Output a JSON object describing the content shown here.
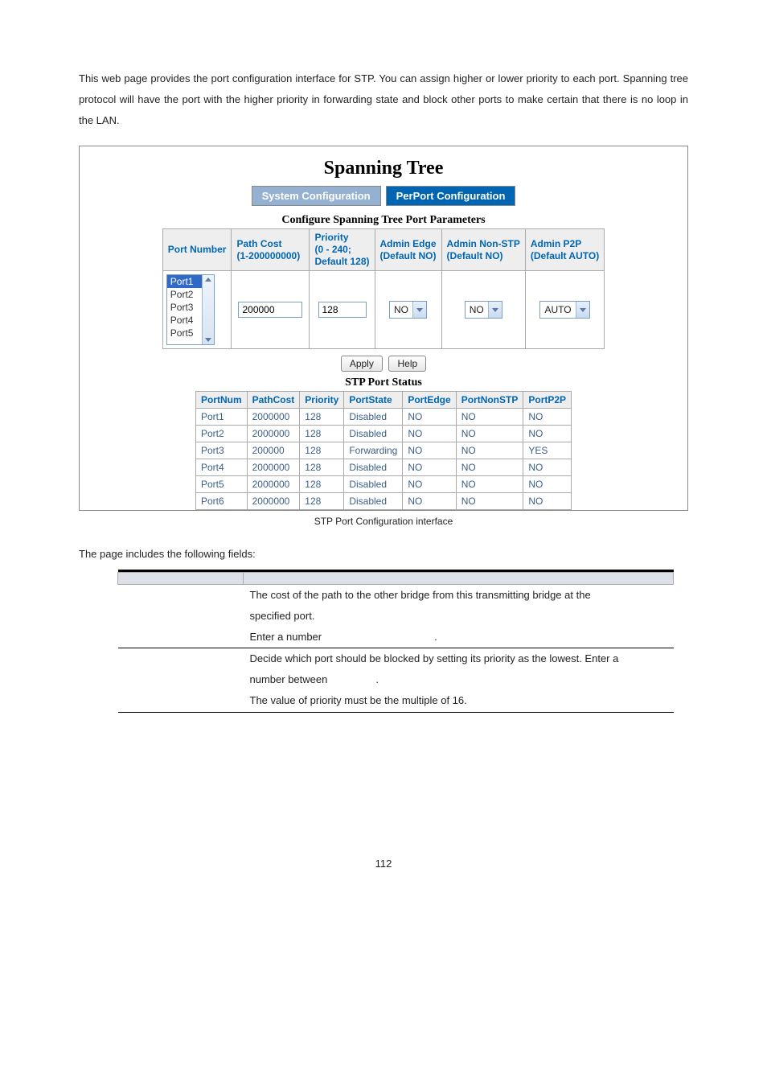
{
  "intro": "This web page provides the port configuration interface for STP. You can assign higher or lower priority to each port. Spanning tree protocol will have the port with the higher priority in forwarding state and block other ports to make certain that there is no loop in the LAN.",
  "screenshot": {
    "title": "Spanning Tree",
    "tabs": {
      "system": "System Configuration",
      "perport": "PerPort Configuration"
    },
    "configure_title": "Configure Spanning Tree Port Parameters",
    "config_headers": {
      "port_number": "Port Number",
      "path_cost": "Path Cost\n(1-200000000)",
      "priority": "Priority\n(0 - 240;\nDefault 128)",
      "admin_edge": "Admin Edge\n(Default NO)",
      "admin_nonstp": "Admin Non-STP\n(Default NO)",
      "admin_p2p": "Admin P2P\n(Default AUTO)"
    },
    "portlist": {
      "items": [
        "Port1",
        "Port2",
        "Port3",
        "Port4",
        "Port5"
      ],
      "selected_index": 0
    },
    "config_values": {
      "path_cost": "200000",
      "priority": "128",
      "admin_edge": "NO",
      "admin_nonstp": "NO",
      "admin_p2p": "AUTO"
    },
    "buttons": {
      "apply": "Apply",
      "help": "Help"
    },
    "status_title": "STP Port Status",
    "status_headers": [
      "PortNum",
      "PathCost",
      "Priority",
      "PortState",
      "PortEdge",
      "PortNonSTP",
      "PortP2P"
    ],
    "status_rows": [
      [
        "Port1",
        "2000000",
        "128",
        "Disabled",
        "NO",
        "NO",
        "NO"
      ],
      [
        "Port2",
        "2000000",
        "128",
        "Disabled",
        "NO",
        "NO",
        "NO"
      ],
      [
        "Port3",
        "200000",
        "128",
        "Forwarding",
        "NO",
        "NO",
        "YES"
      ],
      [
        "Port4",
        "2000000",
        "128",
        "Disabled",
        "NO",
        "NO",
        "NO"
      ],
      [
        "Port5",
        "2000000",
        "128",
        "Disabled",
        "NO",
        "NO",
        "NO"
      ],
      [
        "Port6",
        "2000000",
        "128",
        "Disabled",
        "NO",
        "NO",
        "NO"
      ]
    ]
  },
  "caption": "STP Port Configuration interface",
  "fields_intro": "The page includes the following fields:",
  "fields": {
    "pathcost_line1": "The cost of the path to the other bridge from this transmitting bridge at the",
    "pathcost_line2": "specified port.",
    "pathcost_line3a": "Enter a number",
    "pathcost_line3b": ".",
    "priority_line1": "Decide which port should be blocked by setting its priority as the lowest. Enter a",
    "priority_line2a": "number between",
    "priority_line2b": ".",
    "priority_line3": "The value of priority must be the multiple of 16."
  },
  "pagenum": "112"
}
